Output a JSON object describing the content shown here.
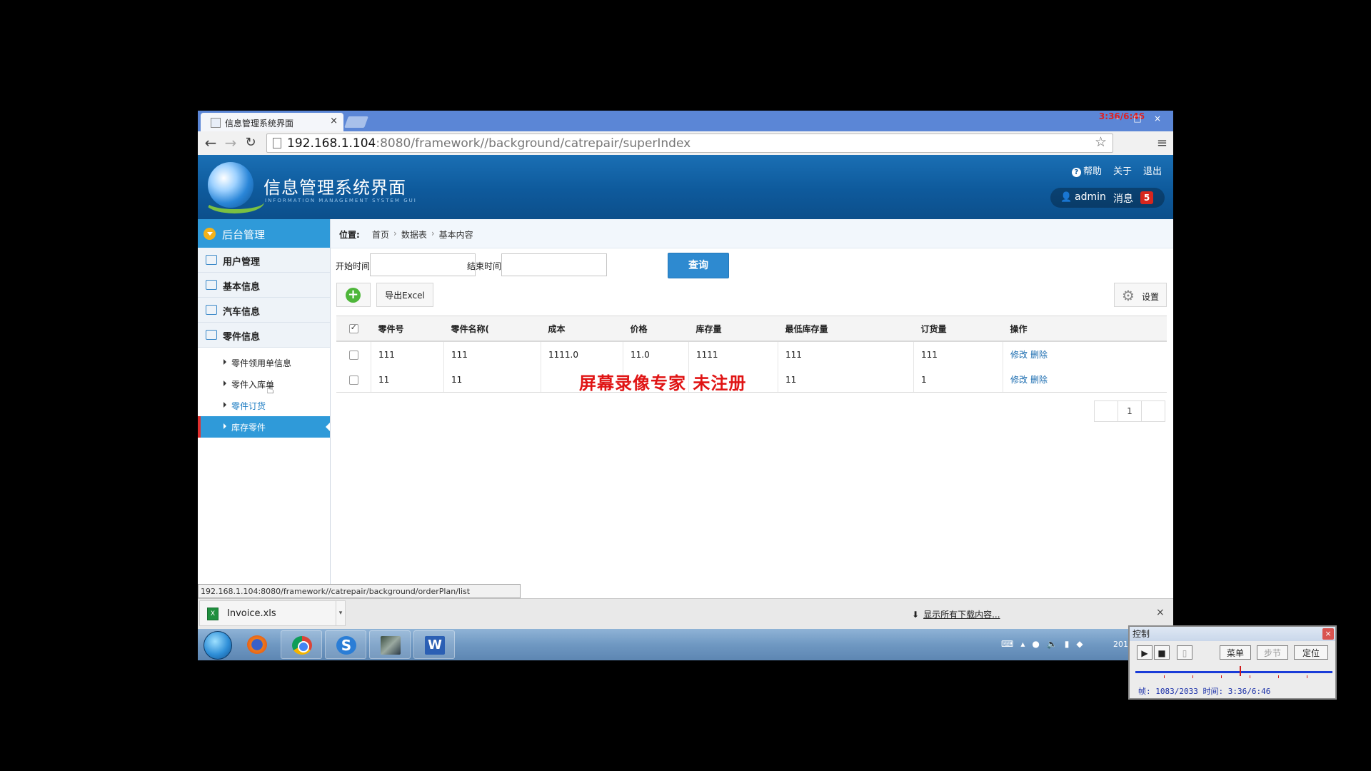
{
  "browser": {
    "tab_title": "信息管理系统界面",
    "tab_close": "×",
    "recording_stamp": "3:36/6:46",
    "window_controls": [
      "-",
      "□",
      "×"
    ],
    "url_host": "192.168.1.104",
    "url_path": ":8080/framework//background/catrepair/superIndex",
    "status_url": "192.168.1.104:8080/framework//catrepair/background/orderPlan/list"
  },
  "header": {
    "title": "信息管理系统界面",
    "subtitle": "INFORMATION MANAGEMENT SYSTEM GUI",
    "links": {
      "help": "帮助",
      "about": "关于",
      "logout": "退出"
    },
    "user": {
      "name": "admin",
      "messages_label": "消息",
      "messages_count": "5"
    }
  },
  "sidebar": {
    "section_title": "后台管理",
    "items": [
      {
        "label": "用户管理"
      },
      {
        "label": "基本信息"
      },
      {
        "label": "汽车信息"
      },
      {
        "label": "零件信息"
      }
    ],
    "subitems": [
      {
        "label": "零件领用单信息"
      },
      {
        "label": "零件入库单"
      },
      {
        "label": "零件订货"
      },
      {
        "label": "库存零件"
      }
    ]
  },
  "breadcrumb": {
    "prefix": "位置:",
    "items": [
      "首页",
      "数据表",
      "基本内容"
    ]
  },
  "filter": {
    "start_label": "开始时间",
    "end_label": "结束时间",
    "start_value": "",
    "end_value": "",
    "query_button": "查询"
  },
  "actions": {
    "export_excel": "导出Excel",
    "settings": "设置"
  },
  "table": {
    "headers": [
      "零件号",
      "零件名称(",
      "成本",
      "价格",
      "库存量",
      "最低库存量",
      "订货量",
      "操作"
    ],
    "rows": [
      [
        "111",
        "111",
        "1111.0",
        "11.0",
        "1111",
        "111",
        "111"
      ],
      [
        "11",
        "11",
        "",
        "",
        "",
        "11",
        "1"
      ]
    ],
    "op_edit": "修改",
    "op_delete": "删除"
  },
  "watermark": "屏幕录像专家  未注册",
  "pager": {
    "current": "1"
  },
  "download_shelf": {
    "file_name": "Invoice.xls",
    "show_all": "显示所有下载内容..."
  },
  "taskbar": {
    "clock_partial": "201"
  },
  "recorder": {
    "title": "控制",
    "menu": "菜单",
    "step": "步节",
    "locate": "定位",
    "status": "帧: 1083/2033 时间: 3:36/6:46",
    "progress": 0.53
  }
}
